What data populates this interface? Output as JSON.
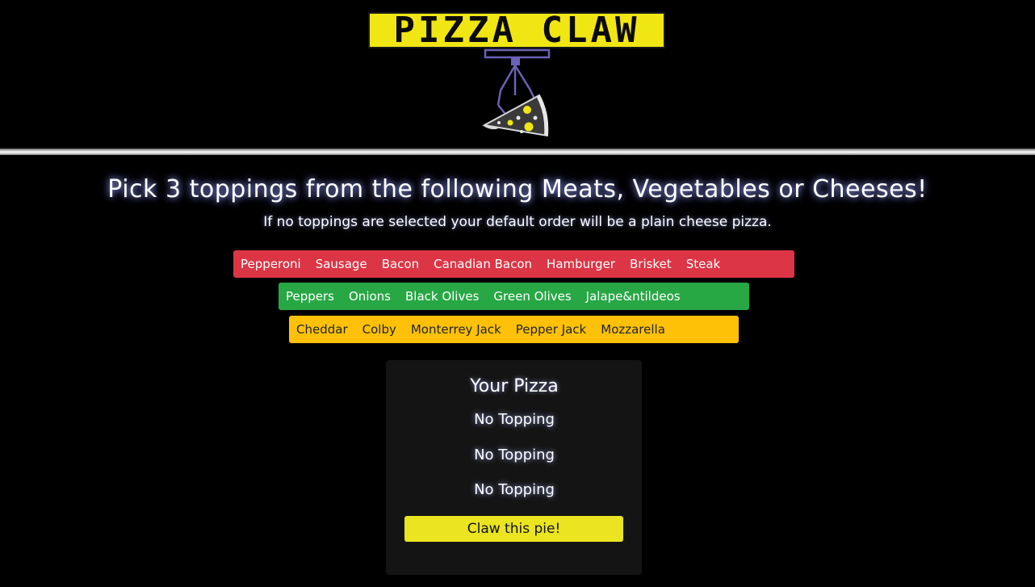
{
  "logo": {
    "title": "PIZZA CLAW",
    "icon": "claw-grabbing-pizza-slice-icon"
  },
  "intro": {
    "headline": "Pick 3 toppings from the following Meats, Vegetables or Cheeses!",
    "subline": "If no toppings are selected your default order will be a plain cheese pizza."
  },
  "toppings": {
    "meats": [
      "Pepperoni",
      "Sausage",
      "Bacon",
      "Canadian Bacon",
      "Hamburger",
      "Brisket",
      "Steak"
    ],
    "vegetables": [
      "Peppers",
      "Onions",
      "Black Olives",
      "Green Olives",
      "Jalape&ntildeos"
    ],
    "cheeses": [
      "Cheddar",
      "Colby",
      "Monterrey Jack",
      "Pepper Jack",
      "Mozzarella"
    ]
  },
  "order": {
    "title": "Your Pizza",
    "slots": [
      "No Topping",
      "No Topping",
      "No Topping"
    ],
    "submit_label": "Claw this pie!"
  },
  "colors": {
    "background": "#000000",
    "logo_yellow": "#f0e614",
    "meats": "#dc3545",
    "vegetables": "#28a745",
    "cheeses": "#ffc107",
    "card": "#141414",
    "submit": "#ebe420",
    "claw": "#6b63b5"
  }
}
